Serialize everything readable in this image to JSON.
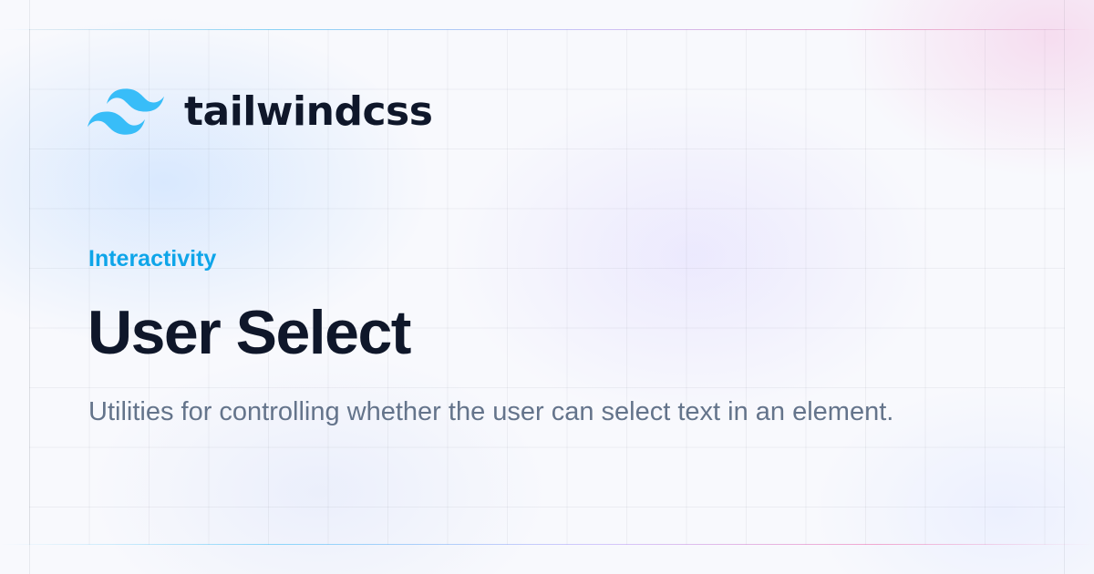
{
  "brand": {
    "logo_icon": "tailwind-wave-icon",
    "wordmark": "tailwindcss",
    "accent": "#38bdf8"
  },
  "category": "Interactivity",
  "title": "User Select",
  "description": "Utilities for controlling whether the user can select text in an element.",
  "colors": {
    "category": "#0ea5e9",
    "title": "#0f172a",
    "description": "#64748b"
  }
}
